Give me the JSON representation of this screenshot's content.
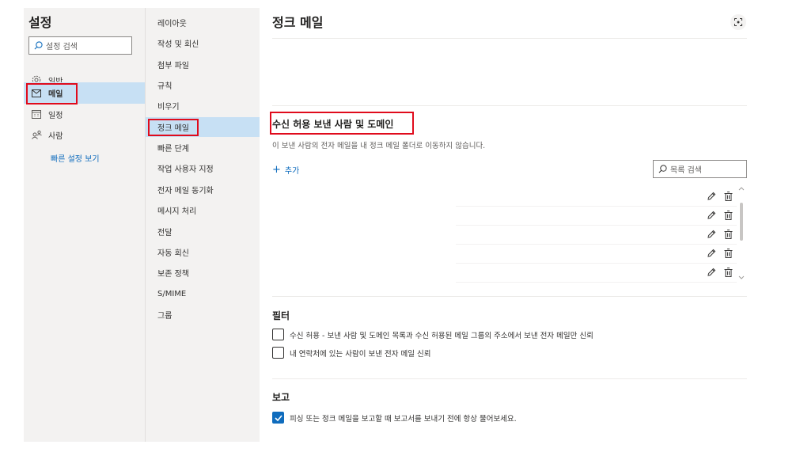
{
  "sidebar": {
    "title": "설정",
    "search_placeholder": "설정 검색",
    "items": [
      {
        "label": "일반",
        "icon": "gear-icon"
      },
      {
        "label": "메일",
        "icon": "mail-icon"
      },
      {
        "label": "일정",
        "icon": "calendar-icon"
      },
      {
        "label": "사람",
        "icon": "people-icon"
      }
    ],
    "quick_settings_link": "빠른 설정 보기"
  },
  "mail_nav": {
    "items": [
      "레이아웃",
      "작성 및 회신",
      "첨부 파일",
      "규칙",
      "비우기",
      "정크 메일",
      "빠른 단계",
      "작업 사용자 지정",
      "전자 메일 동기화",
      "메시지 처리",
      "전달",
      "자동 회신",
      "보존 정책",
      "S/MIME",
      "그룹"
    ],
    "selected_index": 5
  },
  "content": {
    "title": "정크 메일",
    "safe_senders": {
      "title": "수신 허용 보낸 사람 및 도메인",
      "description": "이 보낸 사람의 전자 메일을 내 정크 메일 폴더로 이동하지 않습니다.",
      "add_label": "추가",
      "search_placeholder": "목록 검색",
      "rows": 5
    },
    "filters": {
      "title": "필터",
      "options": [
        {
          "label": "수신 허용 - 보낸 사람 및 도메인 목록과 수신 허용된 메일 그룹의 주소에서 보낸 전자 메일만 신뢰",
          "checked": false
        },
        {
          "label": "내 연락처에 있는 사람이 보낸 전자 메일 신뢰",
          "checked": false
        }
      ]
    },
    "reporting": {
      "title": "보고",
      "options": [
        {
          "label": "피싱 또는 정크 메일을 보고할 때 보고서를 보내기 전에 항상 물어보세요.",
          "checked": true
        }
      ]
    }
  },
  "colors": {
    "accent": "#0f6cbd",
    "selected_bg": "#c7e0f4",
    "highlight_border": "#e00b1c",
    "nav_bg": "#f3f2f1"
  }
}
